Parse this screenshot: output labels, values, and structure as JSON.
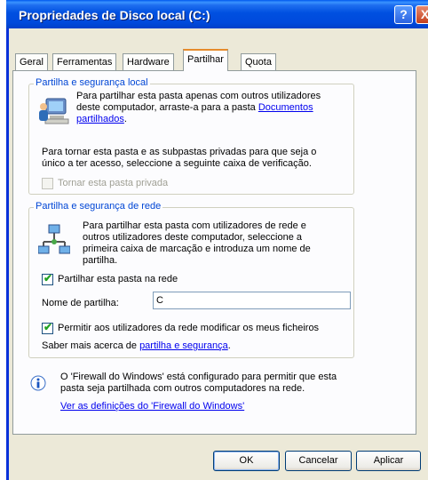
{
  "window": {
    "title": "Propriedades de Disco local (C:)",
    "help_button": "?",
    "close_button": "X"
  },
  "tabs": [
    {
      "label": "Geral",
      "active": false
    },
    {
      "label": "Ferramentas",
      "active": false
    },
    {
      "label": "Hardware",
      "active": false
    },
    {
      "label": "Partilhar",
      "active": true
    },
    {
      "label": "Quota",
      "active": false
    }
  ],
  "local_sharing": {
    "legend": "Partilha e segurança local",
    "desc_line1": "Para partilhar esta pasta apenas com outros utilizadores",
    "desc_line2_prefix": "deste computador, arraste-a para a pasta ",
    "desc_link_part1": "Documentos",
    "desc_link_part2": "partilhados",
    "desc_line3_suffix": ".",
    "private_line1": "Para tornar esta pasta e as subpastas privadas para que seja o",
    "private_line2": "único a ter acesso, seleccione a seguinte caixa de verificação.",
    "private_checkbox_label": "Tornar esta pasta privada",
    "private_checked": false
  },
  "network_sharing": {
    "legend": "Partilha e segurança de rede",
    "desc_line1": "Para partilhar esta pasta com utilizadores de rede e",
    "desc_line2": "outros utilizadores deste computador, seleccione a",
    "desc_line3": "primeira caixa de marcação e introduza um nome de",
    "desc_line4": "partilha.",
    "share_checkbox_label": "Partilhar esta pasta na rede",
    "share_checked": true,
    "share_name_label": "Nome de partilha:",
    "share_name_value": "C",
    "allow_modify_label": "Permitir aos utilizadores da rede modificar os meus ficheiros",
    "allow_modify_checked": true,
    "learn_more_prefix": "Saber mais acerca de ",
    "learn_more_link": "partilha e segurança",
    "learn_more_suffix": "."
  },
  "firewall": {
    "line1": "O 'Firewall do Windows' está configurado para permitir que esta",
    "line2": "pasta seja partilhada com outros computadores na rede.",
    "link": "Ver as definições do 'Firewall do Windows'"
  },
  "buttons": {
    "ok": "OK",
    "cancel": "Cancelar",
    "apply": "Aplicar"
  },
  "colors": {
    "title_bar": "#0050e0",
    "dialog_bg": "#ece9d8",
    "legend_text": "#0046d5",
    "link": "#0000ee",
    "active_tab_accent": "#e68b2c"
  },
  "icons": {
    "local_sharing": "computer-users-icon",
    "network_sharing": "network-icon",
    "firewall_info": "info-icon"
  }
}
